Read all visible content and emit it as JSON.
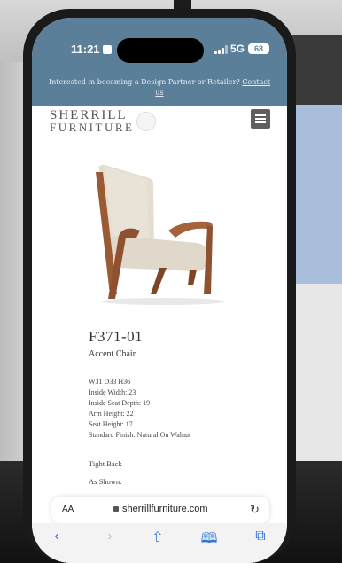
{
  "status_bar": {
    "time": "11:21",
    "network": "5G",
    "battery": "68"
  },
  "banner": {
    "text": "Interested in becoming a Design Partner or Retailer?",
    "link": "Contact us"
  },
  "header": {
    "logo_line1": "SHERRILL",
    "logo_line2": "FURNITURE",
    "menu_icon": "hamburger-icon"
  },
  "product": {
    "sku": "F371-01",
    "name": "Accent Chair",
    "specs": [
      "W31 D33 H36",
      "Inside Width: 23",
      "Inside Seat Depth: 19",
      "Arm Height: 22",
      "Seat Height: 17",
      "Standard Finish: Natural On Walnut"
    ],
    "back_style": "Tight Back",
    "as_shown": "As Shown:"
  },
  "browser": {
    "aa_label": "AA",
    "url": "sherrillfurniture.com",
    "icons": [
      "lock-icon",
      "reload-icon",
      "back-icon",
      "forward-icon",
      "share-icon",
      "bookmarks-icon",
      "tabs-icon"
    ]
  },
  "colors": {
    "banner": "#5b7f98",
    "accent": "#2a73d6"
  }
}
